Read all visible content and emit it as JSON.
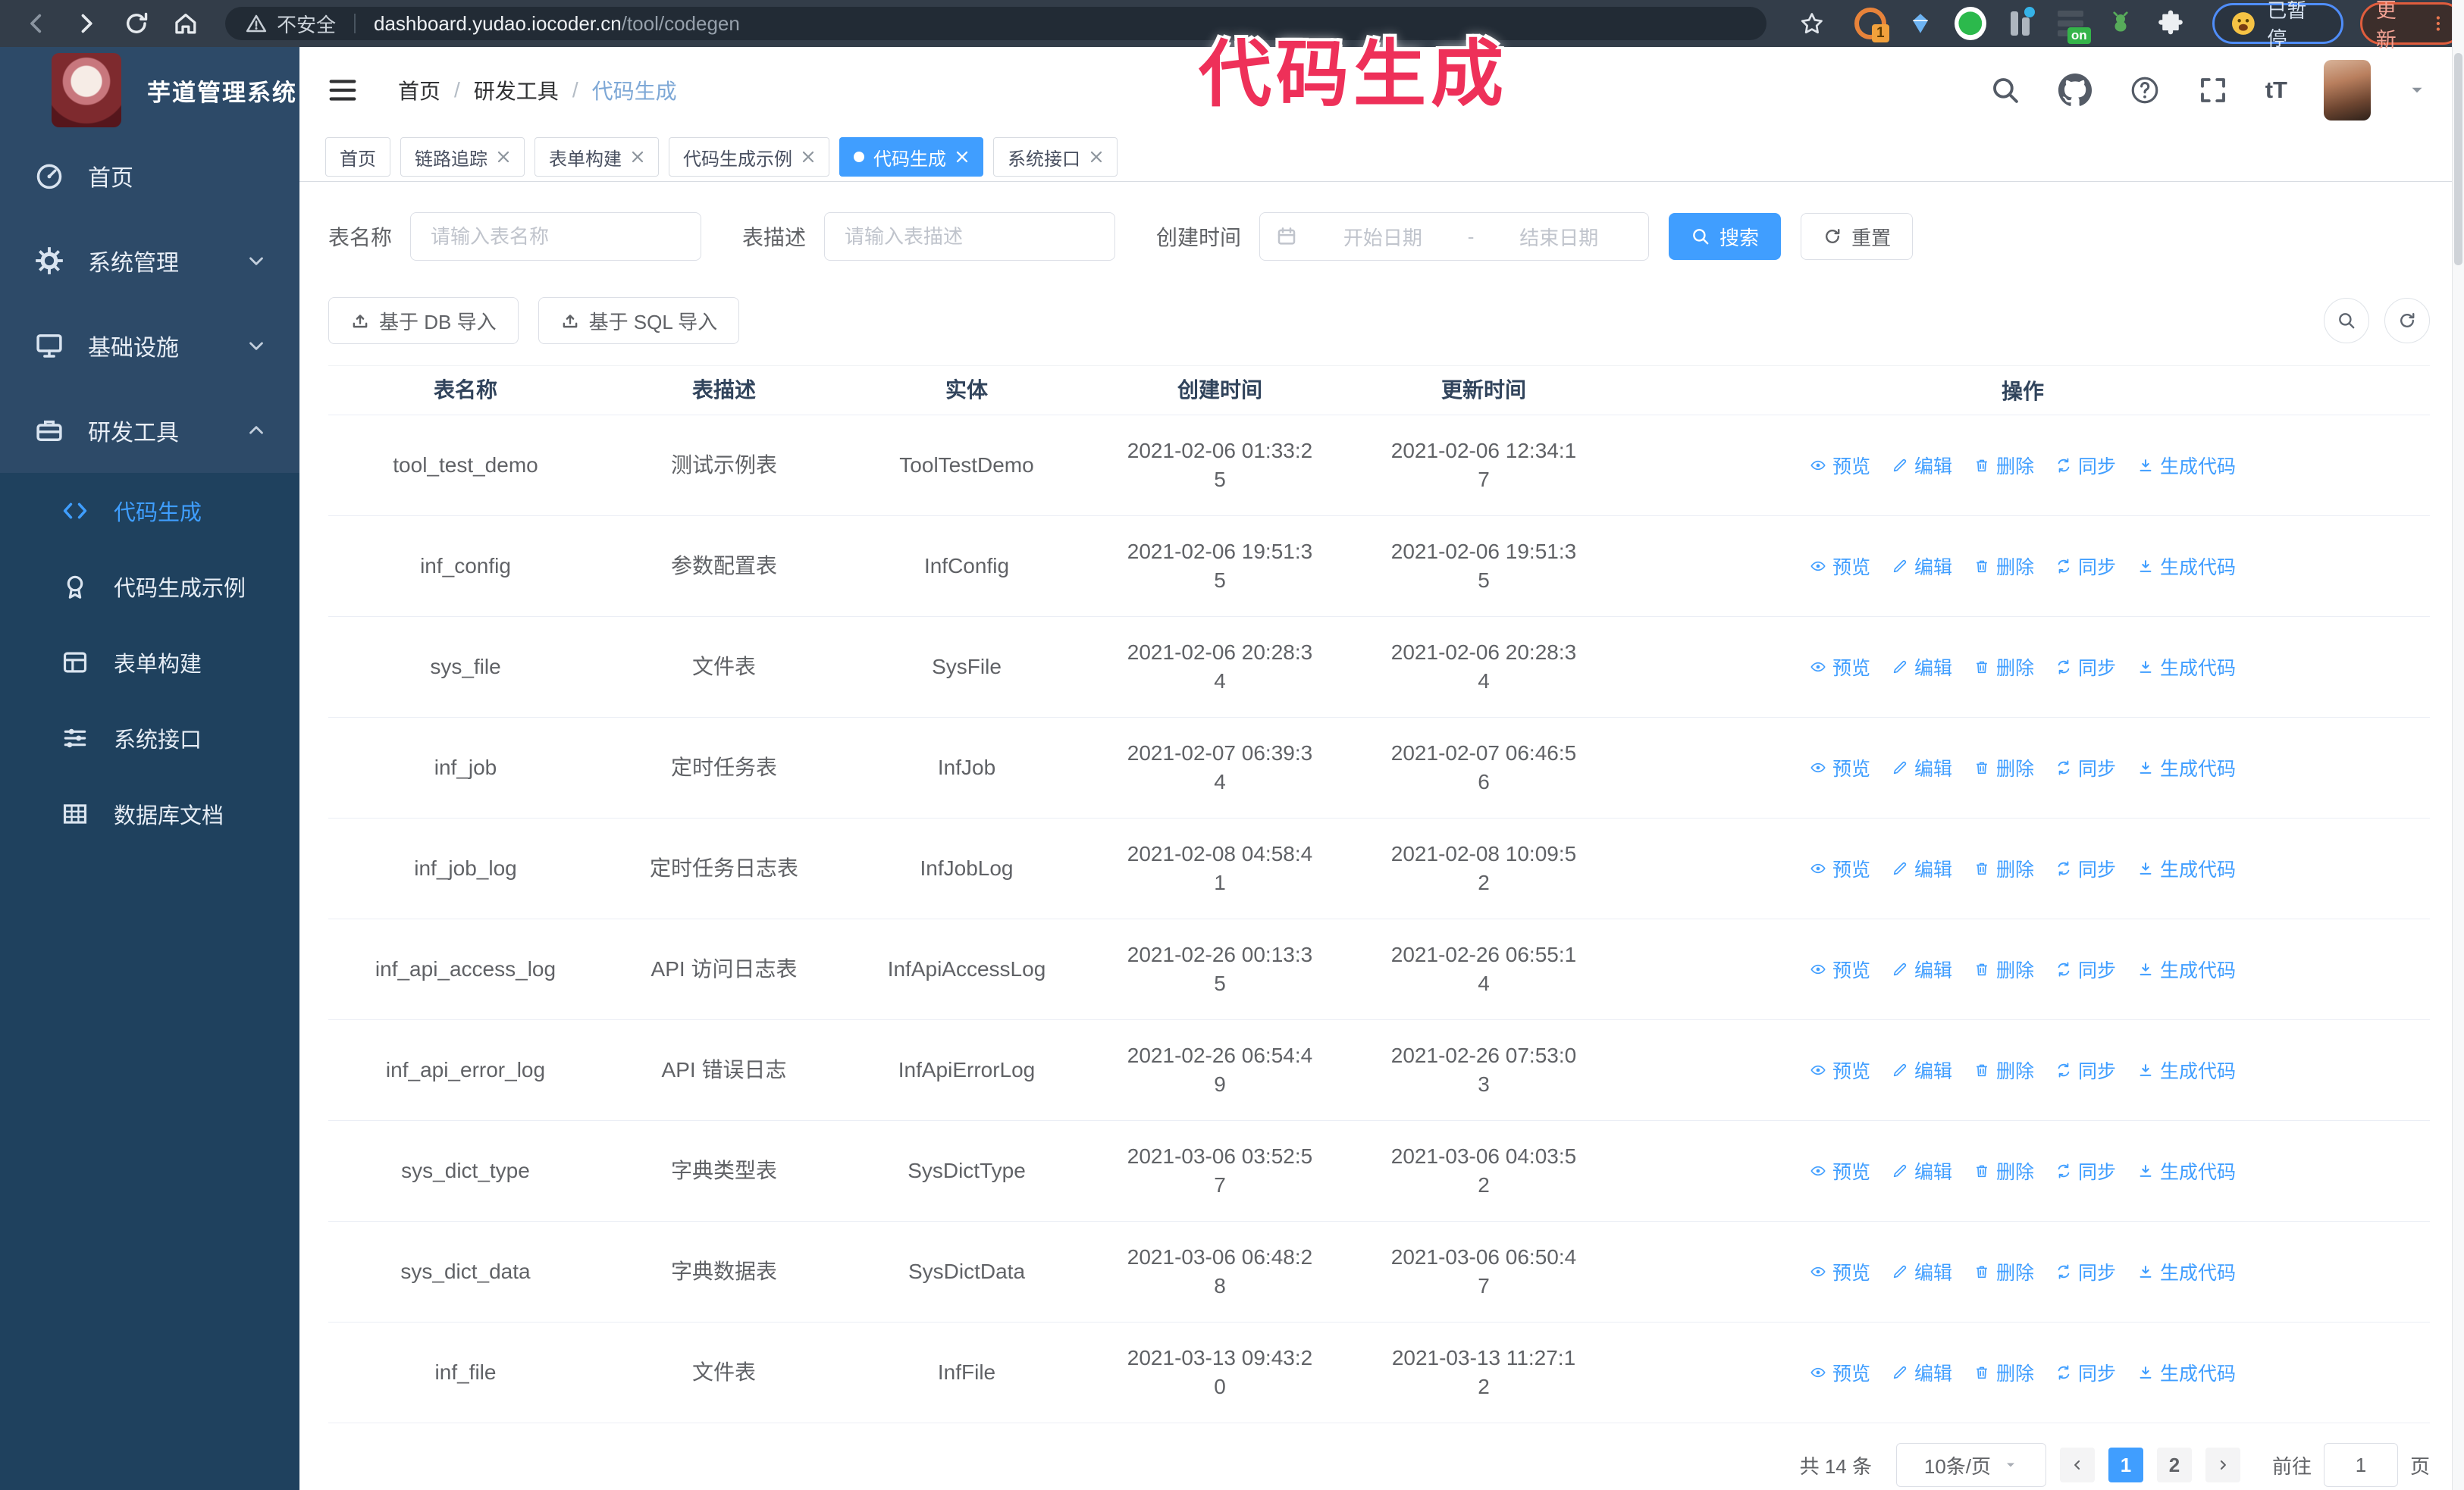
{
  "browser": {
    "security_label": "不安全",
    "url_host": "dashboard.yudao.iocoder.cn",
    "url_path": "/tool/codegen",
    "extension_badge": "1",
    "extension_on_badge": "on",
    "paused_label": "已暂停",
    "update_label": "更新"
  },
  "annotation": {
    "text": "代码生成"
  },
  "sidebar": {
    "logo_title": "芋道管理系统",
    "menu": [
      {
        "label": "首页",
        "icon": "dashboard-icon"
      },
      {
        "label": "系统管理",
        "icon": "gear-icon"
      },
      {
        "label": "基础设施",
        "icon": "monitor-icon"
      },
      {
        "label": "研发工具",
        "icon": "toolbox-icon"
      }
    ],
    "submenu": [
      {
        "label": "代码生成",
        "icon": "code-icon",
        "active": true
      },
      {
        "label": "代码生成示例",
        "icon": "badge-icon"
      },
      {
        "label": "表单构建",
        "icon": "form-icon"
      },
      {
        "label": "系统接口",
        "icon": "api-icon"
      },
      {
        "label": "数据库文档",
        "icon": "database-doc-icon"
      }
    ]
  },
  "navbar": {
    "breadcrumb": [
      "首页",
      "研发工具",
      "代码生成"
    ],
    "breadcrumb_separator": "/",
    "text_size_label": "tT"
  },
  "tabs": [
    {
      "label": "首页",
      "closable": false,
      "active": false
    },
    {
      "label": "链路追踪",
      "closable": true,
      "active": false
    },
    {
      "label": "表单构建",
      "closable": true,
      "active": false
    },
    {
      "label": "代码生成示例",
      "closable": true,
      "active": false
    },
    {
      "label": "代码生成",
      "closable": true,
      "active": true
    },
    {
      "label": "系统接口",
      "closable": true,
      "active": false
    }
  ],
  "search_form": {
    "table_name_label": "表名称",
    "table_name_placeholder": "请输入表名称",
    "table_desc_label": "表描述",
    "table_desc_placeholder": "请输入表描述",
    "create_time_label": "创建时间",
    "start_date_placeholder": "开始日期",
    "range_separator": "-",
    "end_date_placeholder": "结束日期",
    "search_label": "搜索",
    "reset_label": "重置"
  },
  "toolbar": {
    "import_db_label": "基于 DB 导入",
    "import_sql_label": "基于 SQL 导入"
  },
  "table": {
    "headers": [
      "表名称",
      "表描述",
      "实体",
      "创建时间",
      "更新时间",
      "操作"
    ],
    "actions": [
      "预览",
      "编辑",
      "删除",
      "同步",
      "生成代码"
    ],
    "rows": [
      {
        "name": "tool_test_demo",
        "desc": "测试示例表",
        "entity": "ToolTestDemo",
        "created": "2021-02-06 01:33:25",
        "updated": "2021-02-06 12:34:17"
      },
      {
        "name": "inf_config",
        "desc": "参数配置表",
        "entity": "InfConfig",
        "created": "2021-02-06 19:51:35",
        "updated": "2021-02-06 19:51:35"
      },
      {
        "name": "sys_file",
        "desc": "文件表",
        "entity": "SysFile",
        "created": "2021-02-06 20:28:34",
        "updated": "2021-02-06 20:28:34"
      },
      {
        "name": "inf_job",
        "desc": "定时任务表",
        "entity": "InfJob",
        "created": "2021-02-07 06:39:34",
        "updated": "2021-02-07 06:46:56"
      },
      {
        "name": "inf_job_log",
        "desc": "定时任务日志表",
        "entity": "InfJobLog",
        "created": "2021-02-08 04:58:41",
        "updated": "2021-02-08 10:09:52"
      },
      {
        "name": "inf_api_access_log",
        "desc": "API 访问日志表",
        "entity": "InfApiAccessLog",
        "created": "2021-02-26 00:13:35",
        "updated": "2021-02-26 06:55:14"
      },
      {
        "name": "inf_api_error_log",
        "desc": "API 错误日志",
        "entity": "InfApiErrorLog",
        "created": "2021-02-26 06:54:49",
        "updated": "2021-02-26 07:53:03"
      },
      {
        "name": "sys_dict_type",
        "desc": "字典类型表",
        "entity": "SysDictType",
        "created": "2021-03-06 03:52:57",
        "updated": "2021-03-06 04:03:52"
      },
      {
        "name": "sys_dict_data",
        "desc": "字典数据表",
        "entity": "SysDictData",
        "created": "2021-03-06 06:48:28",
        "updated": "2021-03-06 06:50:47"
      },
      {
        "name": "inf_file",
        "desc": "文件表",
        "entity": "InfFile",
        "created": "2021-03-13 09:43:20",
        "updated": "2021-03-13 11:27:12"
      }
    ]
  },
  "pagination": {
    "total_label": "共 14 条",
    "page_size_label": "10条/页",
    "pages": [
      "1",
      "2"
    ],
    "active_page": "1",
    "goto_label": "前往",
    "goto_value": "1",
    "page_suffix_label": "页"
  },
  "colors": {
    "primary": "#409eff",
    "sidebar_bg": "#2d4a68",
    "submenu_bg": "#1f415e",
    "annotation": "#ee3059",
    "browser_bar": "#333d49"
  }
}
